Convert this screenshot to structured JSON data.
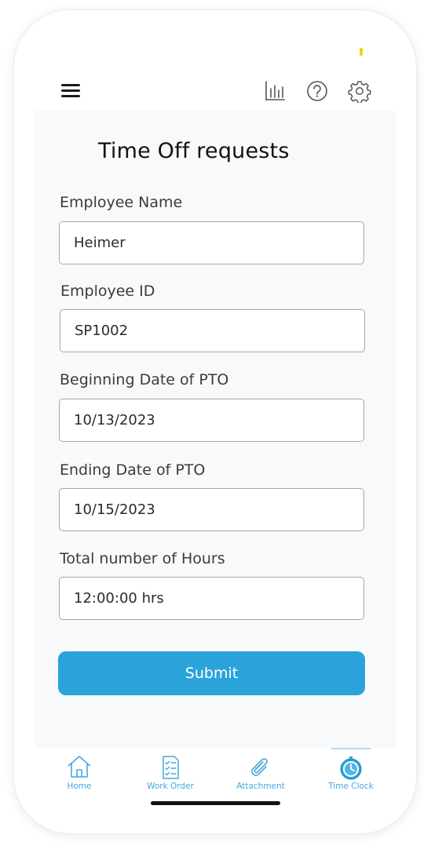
{
  "header": {
    "menu_icon": "hamburger-menu-icon",
    "icons": [
      "bar-chart-icon",
      "help-icon",
      "gear-icon"
    ]
  },
  "form": {
    "title": "Time Off requests",
    "fields": [
      {
        "label": "Employee Name",
        "value": "Heimer"
      },
      {
        "label": "Employee ID",
        "value": "SP1002"
      },
      {
        "label": "Beginning Date of PTO",
        "value": "10/13/2023"
      },
      {
        "label": "Ending Date of PTO",
        "value": "10/15/2023"
      },
      {
        "label": "Total number of Hours",
        "value": "12:00:00 hrs"
      }
    ],
    "submit_label": "Submit"
  },
  "tabbar": {
    "tabs": [
      {
        "label": "Home",
        "icon": "home-icon"
      },
      {
        "label": "Work Order",
        "icon": "clipboard-checklist-icon"
      },
      {
        "label": "Attachment",
        "icon": "paperclip-icon"
      },
      {
        "label": "Time Clock",
        "icon": "clock-icon"
      }
    ],
    "active": "Time Clock"
  },
  "colors": {
    "accent": "#2aa3db",
    "tab_label": "#45a9dd",
    "background": "#f8f9fa"
  }
}
